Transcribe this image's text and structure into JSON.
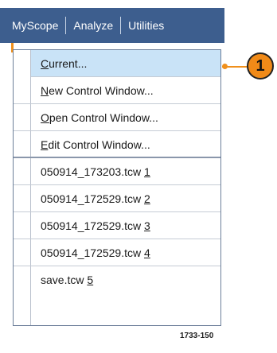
{
  "menubar": {
    "items": [
      {
        "label": "MyScope"
      },
      {
        "label": "Analyze"
      },
      {
        "label": "Utilities"
      }
    ]
  },
  "dropdown": {
    "items": [
      {
        "pre": "",
        "ul": "C",
        "post": "urrent...",
        "highlighted": true
      },
      {
        "pre": "",
        "ul": "N",
        "post": "ew Control Window..."
      },
      {
        "pre": "",
        "ul": "O",
        "post": "pen Control Window..."
      },
      {
        "pre": "",
        "ul": "E",
        "post": "dit Control Window..."
      },
      {
        "pre": "050914_173203.tcw ",
        "ul": "1",
        "post": ""
      },
      {
        "pre": "050914_172529.tcw ",
        "ul": "2",
        "post": ""
      },
      {
        "pre": "050914_172529.tcw ",
        "ul": "3",
        "post": ""
      },
      {
        "pre": "050914_172529.tcw ",
        "ul": "4",
        "post": ""
      },
      {
        "pre": "save.tcw ",
        "ul": "5",
        "post": ""
      }
    ]
  },
  "callout": {
    "number": "1"
  },
  "figure_id": "1733-150",
  "colors": {
    "menubar": "#3d5e8e",
    "highlight": "#c9e3f7",
    "callout": "#f08a18"
  }
}
